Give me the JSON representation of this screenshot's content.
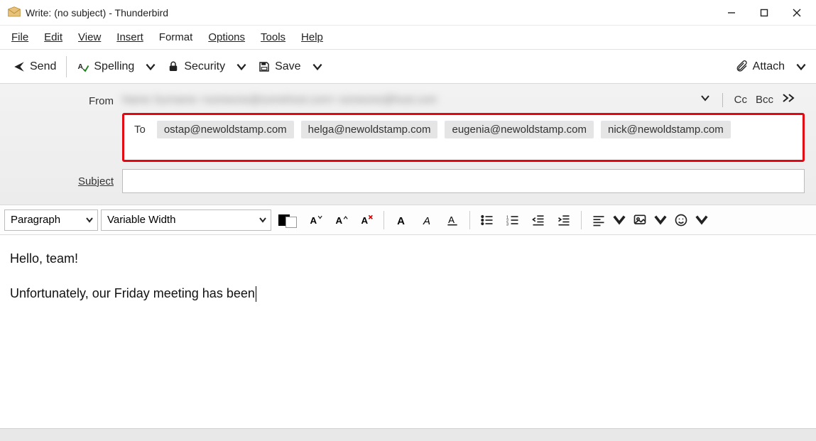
{
  "window": {
    "title": "Write: (no subject) - Thunderbird"
  },
  "menu": {
    "file": "File",
    "edit": "Edit",
    "view": "View",
    "insert": "Insert",
    "format": "Format",
    "options": "Options",
    "tools": "Tools",
    "help": "Help"
  },
  "toolbar": {
    "send": "Send",
    "spelling": "Spelling",
    "security": "Security",
    "save": "Save",
    "attach": "Attach"
  },
  "headers": {
    "from_label": "From",
    "from_value": "Name Surname <someone@somehost.com> someone@host.com",
    "cc": "Cc",
    "bcc": "Bcc",
    "to_label": "To",
    "recipients": [
      "ostap@newoldstamp.com",
      "helga@newoldstamp.com",
      "eugenia@newoldstamp.com",
      "nick@newoldstamp.com"
    ],
    "subject_label": "Subject",
    "subject_value": ""
  },
  "format": {
    "paragraph": "Paragraph",
    "font": "Variable Width"
  },
  "body": {
    "line1": "Hello, team!",
    "line2": "Unfortunately, our Friday meeting has been"
  }
}
